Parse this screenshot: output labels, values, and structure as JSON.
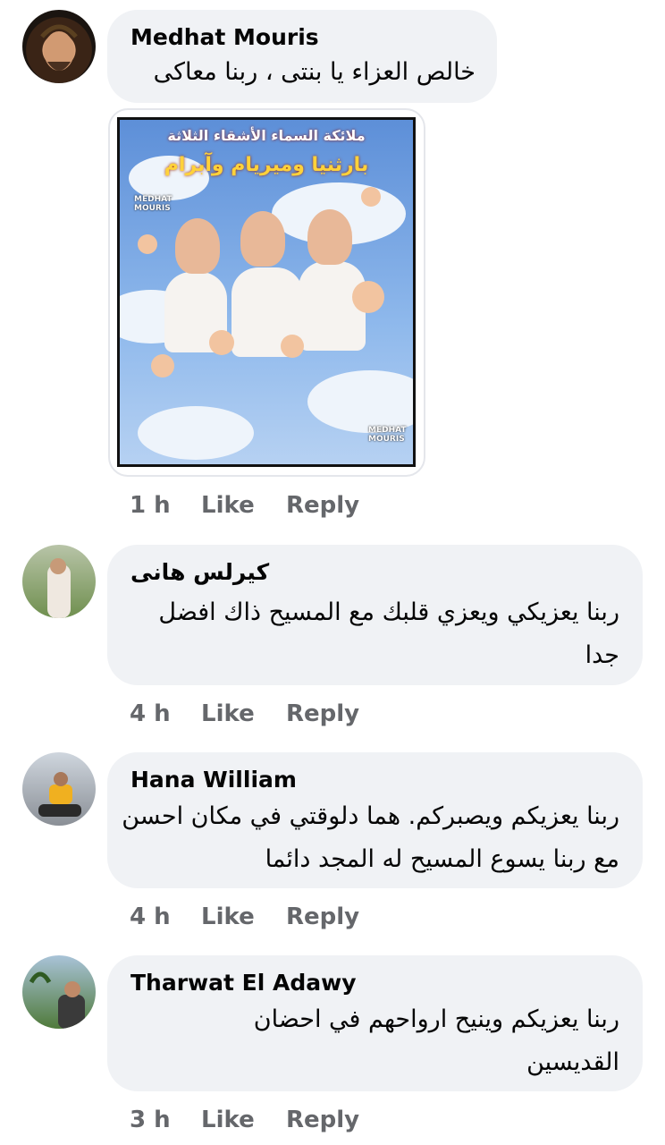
{
  "comments": [
    {
      "author": "Medhat Mouris",
      "text": "خالص العزاء يا بنتى ، ربنا معاكى",
      "time": "1 h",
      "like": "Like",
      "reply": "Reply",
      "attachment": {
        "title_line1": "ملائكة السماء الأشقاء الثلاثة",
        "title_line2": "بارثنيا وميريام وآبرام",
        "watermark": "MEDHAT\nMOURIS"
      }
    },
    {
      "author": "كيرلس هانى",
      "text": "ربنا يعزيكي ويعزي قلبك مع المسيح ذاك افضل جدا",
      "time": "4 h",
      "like": "Like",
      "reply": "Reply"
    },
    {
      "author": "Hana William",
      "text": "ربنا يعزيكم ويصبركم.   هما دلوقتي في مكان احسن مع ربنا يسوع المسيح له المجد دائما",
      "time": "4 h",
      "like": "Like",
      "reply": "Reply"
    },
    {
      "author": "Tharwat El Adawy",
      "text": "ربنا يعزيكم وينيح ارواحهم في احضان القديسين",
      "time": "3 h",
      "like": "Like",
      "reply": "Reply"
    }
  ]
}
